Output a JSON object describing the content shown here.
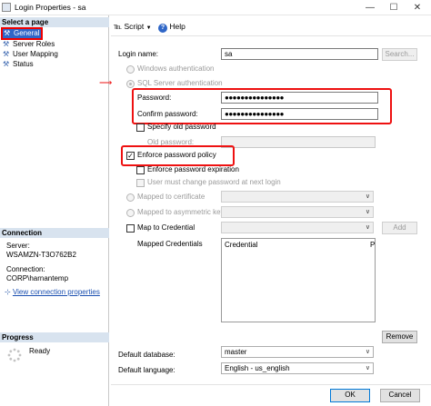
{
  "window": {
    "title": "Login Properties - sa"
  },
  "left": {
    "select_page_label": "Select a page",
    "pages": [
      "General",
      "Server Roles",
      "User Mapping",
      "Status"
    ],
    "connection_label": "Connection",
    "server_label": "Server:",
    "server_value": "WSAMZN-T3O762B2",
    "connection_field_label": "Connection:",
    "connection_value": "CORP\\harnantemp",
    "view_connection_link": "View connection properties",
    "progress_label": "Progress",
    "progress_status": "Ready"
  },
  "toolbar": {
    "script": "Script",
    "help": "Help"
  },
  "form": {
    "login_name_label": "Login name:",
    "login_name_value": "sa",
    "search_button": "Search...",
    "windows_auth": "Windows authentication",
    "sql_auth": "SQL Server authentication",
    "password_label": "Password:",
    "password_value": "●●●●●●●●●●●●●●●",
    "confirm_password_label": "Confirm password:",
    "confirm_password_value": "●●●●●●●●●●●●●●●",
    "specify_old_password": "Specify old password",
    "old_password_label": "Old password:",
    "enforce_policy": "Enforce password policy",
    "enforce_expiration": "Enforce password expiration",
    "must_change": "User must change password at next login",
    "mapped_cert": "Mapped to certificate",
    "mapped_asym": "Mapped to asymmetric key",
    "map_credential": "Map to Credential",
    "add_button": "Add",
    "mapped_credentials_label": "Mapped Credentials",
    "credential_col": "Credential",
    "provider_col": "P",
    "remove_button": "Remove",
    "default_database_label": "Default database:",
    "default_database_value": "master",
    "default_language_label": "Default language:",
    "default_language_value": "English - us_english"
  },
  "buttons": {
    "ok": "OK",
    "cancel": "Cancel"
  }
}
